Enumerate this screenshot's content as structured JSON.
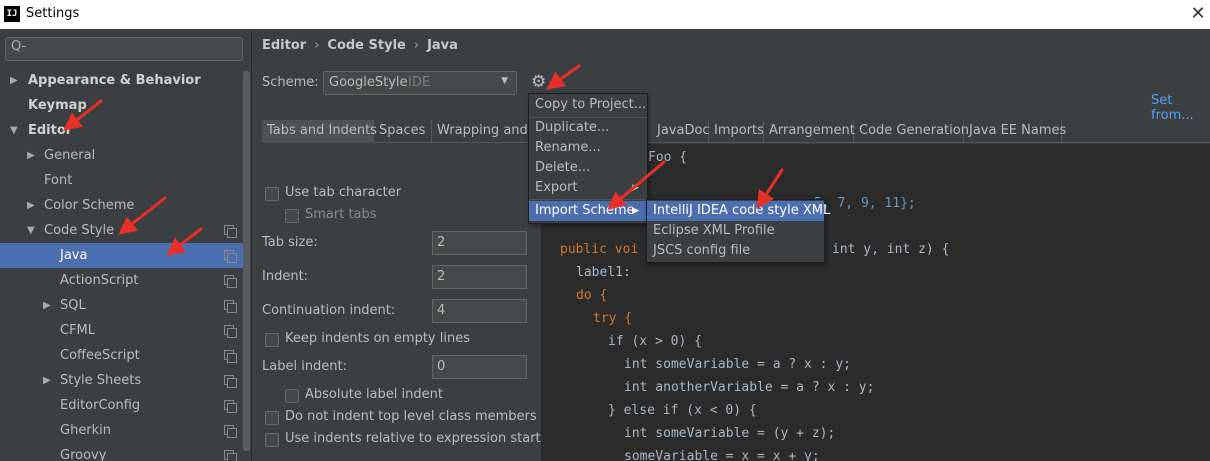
{
  "window": {
    "title": "Settings",
    "app_icon_text": "IJ",
    "close_glyph": "✕"
  },
  "sidebar": {
    "search_glyph": "Q-",
    "items": [
      {
        "label": "Appearance & Behavior"
      },
      {
        "label": "Keymap"
      },
      {
        "label": "Editor"
      },
      {
        "label": "General"
      },
      {
        "label": "Font"
      },
      {
        "label": "Color Scheme"
      },
      {
        "label": "Code Style"
      },
      {
        "label": "Java"
      },
      {
        "label": "ActionScript"
      },
      {
        "label": "SQL"
      },
      {
        "label": "CFML"
      },
      {
        "label": "CoffeeScript"
      },
      {
        "label": "Style Sheets"
      },
      {
        "label": "EditorConfig"
      },
      {
        "label": "Gherkin"
      },
      {
        "label": "Groovy"
      }
    ]
  },
  "breadcrumb": {
    "a": "Editor",
    "b": "Code Style",
    "c": "Java",
    "sep": "›"
  },
  "scheme": {
    "label": "Scheme:",
    "value": "GoogleStyle",
    "tag": "IDE",
    "set_from": "Set from..."
  },
  "tabs": [
    "Tabs and Indents",
    "Spaces",
    "Wrapping and B",
    "JavaDoc",
    "Imports",
    "Arrangement",
    "Code Generation",
    "Java EE Names"
  ],
  "options": {
    "use_tab": "Use tab character",
    "smart_tabs": "Smart tabs",
    "tab_size_label": "Tab size:",
    "tab_size": "2",
    "indent_label": "Indent:",
    "indent": "2",
    "cont_label": "Continuation indent:",
    "cont": "4",
    "keep_indents": "Keep indents on empty lines",
    "label_indent_label": "Label indent:",
    "label_indent": "0",
    "abs_label": "Absolute label indent",
    "no_indent_top": "Do not indent top level class members",
    "relative": "Use indents relative to expression start"
  },
  "code": {
    "l1": "Foo {",
    "l2": "5, 7, 9, 11};",
    "l3a": "public voi",
    "l3b": "int y, int z) {",
    "l4": "label1:",
    "l5": "do {",
    "l6": "try {",
    "l7": "if (x > 0) {",
    "l8": "int someVariable = a ? x : y;",
    "l9": "int anotherVariable = a ? x : y;",
    "l10": "} else if (x < 0) {",
    "l11": "int someVariable = (y + z);",
    "l12": "someVariable = x = x + y;"
  },
  "menu": {
    "copy": "Copy to Project...",
    "duplicate": "Duplicate...",
    "rename": "Rename...",
    "delete": "Delete...",
    "export": "Export",
    "import": "Import Scheme",
    "submenu_glyph": "▶"
  },
  "submenu": {
    "intellij": "IntelliJ IDEA code style XML",
    "eclipse": "Eclipse XML Profile",
    "jscs": "JSCS config file"
  },
  "colors": {
    "accent": "#4b6eaf",
    "annotation_arrow": "#e8302a",
    "link": "#589df6"
  }
}
